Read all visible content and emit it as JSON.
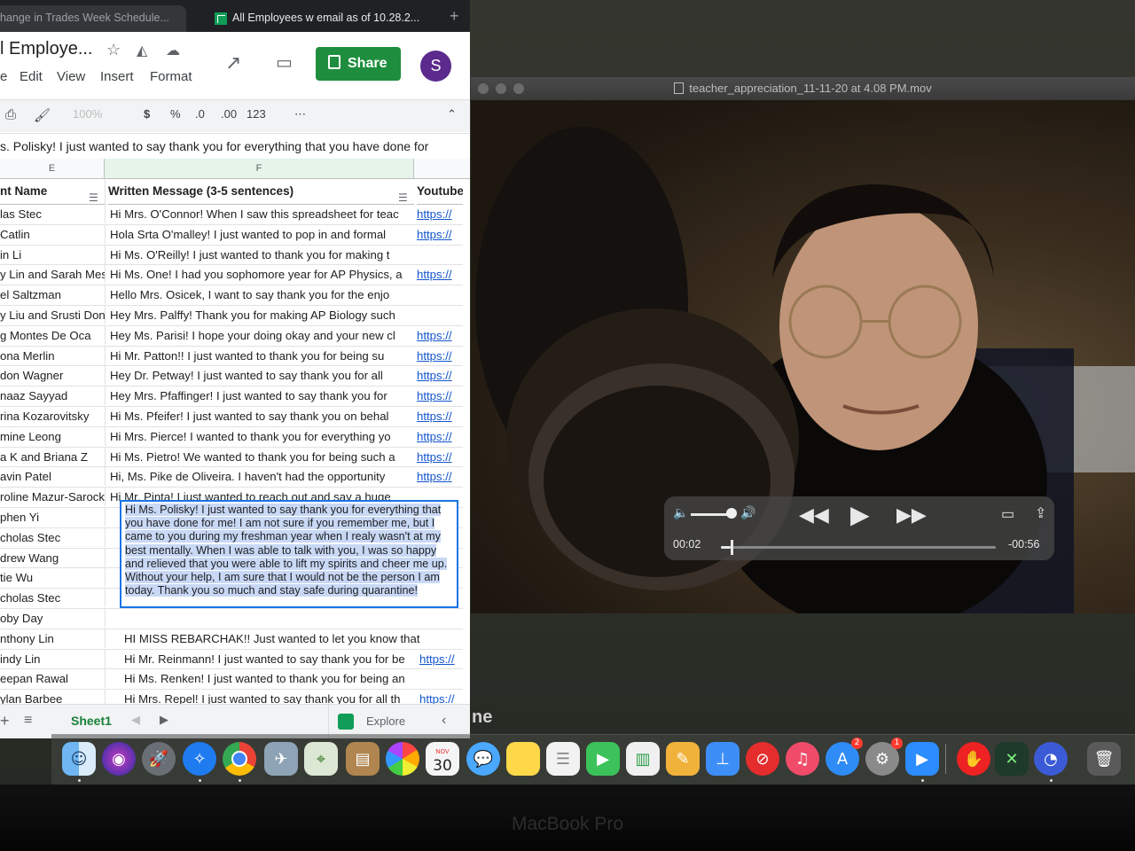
{
  "browser": {
    "tabs": [
      {
        "label": "hange in Trades Week Schedule..."
      },
      {
        "label": "All Employees w email as of 10.28.2..."
      }
    ],
    "new_tab_label": "+"
  },
  "sheets": {
    "doc_title": "l Employe...",
    "menu": [
      "e",
      "Edit",
      "View",
      "Insert",
      "Format"
    ],
    "share_label": "Share",
    "avatar_letter": "S",
    "toolbar": {
      "zoom": "100%",
      "currency": "$",
      "percent": "%",
      "dec_less": ".0",
      "dec_more": ".00",
      "format": "123",
      "more": "⋯"
    },
    "formula_text": "s. Polisky! I just wanted to say thank you for everything that you have done for",
    "col_headers": [
      "E",
      "F"
    ],
    "header_row": [
      "nt Name",
      "Written Message (3-5 sentences)",
      "Youtube"
    ],
    "rows": [
      {
        "name": "las Stec",
        "msg": "Hi Mrs. O'Connor! When I saw this spreadsheet for teac",
        "link": "https://"
      },
      {
        "name": "Catlin",
        "msg": "Hola Srta O'malley! I just wanted to pop in and formal",
        "link": "https://"
      },
      {
        "name": "in Li",
        "msg": "Hi Ms. O'Reilly! I just wanted to thank you for making t",
        "link": ""
      },
      {
        "name": "y Lin and Sarah Mes",
        "msg": "Hi Ms. One! I had you sophomore year for AP Physics, a",
        "link": "https://"
      },
      {
        "name": "el Saltzman",
        "msg": "Hello Mrs. Osicek, I want to say thank you for the enjo",
        "link": ""
      },
      {
        "name": "y Liu and Srusti Don",
        "msg": "Hey Mrs. Palffy! Thank you for making AP Biology such",
        "link": ""
      },
      {
        "name": "g Montes De Oca",
        "msg": "Hey Ms. Parisi! I hope your doing okay and your new cl",
        "link": "https://"
      },
      {
        "name": "ona Merlin",
        "msg": "Hi Mr. Patton!! I just wanted to thank you for being su",
        "link": "https://"
      },
      {
        "name": "don Wagner",
        "msg": "Hey Dr. Petway! I just wanted to say thank you for all",
        "link": "https://"
      },
      {
        "name": "naaz Sayyad",
        "msg": "Hey Mrs. Pfaffinger! I just wanted to say thank you for",
        "link": "https://"
      },
      {
        "name": "rina Kozarovitsky",
        "msg": "Hi Ms. Pfeifer! I just wanted to say thank you on behal",
        "link": "https://"
      },
      {
        "name": "mine Leong",
        "msg": "Hi Mrs. Pierce! I wanted to thank you for everything yo",
        "link": "https://"
      },
      {
        "name": "a K and Briana Z",
        "msg": "Hi Ms. Pietro! We wanted to thank you for being such a",
        "link": "https://"
      },
      {
        "name": "avin Patel",
        "msg": "Hi, Ms. Pike de Oliveira. I haven't had the opportunity",
        "link": "https://"
      },
      {
        "name": "roline Mazur-Sarocka",
        "msg": "Hi Mr. Pinta! I just wanted to reach out and say a huge",
        "link": ""
      },
      {
        "name": "phen Yi",
        "msg": "",
        "link": ""
      },
      {
        "name": "cholas Stec",
        "msg": "",
        "link": ""
      },
      {
        "name": "drew Wang",
        "msg": "",
        "link": ""
      },
      {
        "name": "tie Wu",
        "msg": "",
        "link": ""
      },
      {
        "name": "cholas Stec",
        "msg": "",
        "link": ""
      },
      {
        "name": "oby Day",
        "msg": "",
        "link": ""
      },
      {
        "name": "nthony Lin",
        "msg": "HI MISS REBARCHAK!! Just wanted to let you know that",
        "link": ""
      },
      {
        "name": "indy Lin",
        "msg": "Hi Mr. Reinmann! I just wanted to say thank you for be",
        "link": "https://"
      },
      {
        "name": "eepan Rawal",
        "msg": "Hi Ms. Renken! I just wanted to thank you for being an",
        "link": ""
      },
      {
        "name": "ylan Barbee",
        "msg": "Hi Mrs. Repel! I just wanted to say thank you for all th",
        "link": "https://"
      }
    ],
    "editor_text": "Hi Ms. Polisky! I just wanted to say thank you for everything that you have done for me! I am not sure if you remember me, but I came to you during my freshman year when I realy wasn't at my best mentally. When I was able to talk with you, I was so happy and relieved that you were able to lift my spirits and cheer me up. Without your help, I am sure that I would not be the person I am today. Thank you so much and stay safe during quarantine!",
    "sheet_tab": "Sheet1",
    "explore_label": "Explore"
  },
  "quicktime": {
    "title": "teacher_appreciation_11-11-20 at 4.08 PM.mov",
    "elapsed": "00:02",
    "remaining": "-00:56",
    "progress_fraction": 0.035,
    "volume_fraction": 0.9
  },
  "background_text": "ne",
  "dock": {
    "calendar_month": "NOV",
    "calendar_day": "30",
    "appstore_badge": "2",
    "prefs_badge": "1"
  },
  "hardware_label": "MacBook Pro"
}
